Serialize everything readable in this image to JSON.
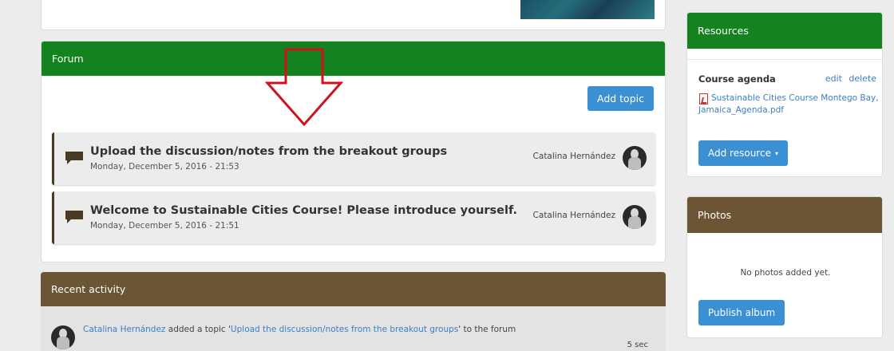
{
  "forum": {
    "header": "Forum",
    "add_topic_label": "Add topic",
    "topics": [
      {
        "title": "Upload the discussion/notes from the breakout groups",
        "date": "Monday, December 5, 2016 - 21:53",
        "author": "Catalina Hernández"
      },
      {
        "title": "Welcome to Sustainable Cities Course! Please introduce yourself.",
        "date": "Monday, December 5, 2016 - 21:51",
        "author": "Catalina Hernández"
      }
    ]
  },
  "activity": {
    "header": "Recent activity",
    "items": [
      {
        "user": "Catalina Hernández",
        "text_before": " added a topic '",
        "topic": "Upload the discussion/notes from the breakout groups",
        "text_after": "' to the forum",
        "time": "5 sec"
      }
    ]
  },
  "resources": {
    "header": "Resources",
    "item_title": "Course agenda",
    "edit_label": "edit",
    "delete_label": "delete",
    "file_name": "Sustainable Cities Course Montego Bay, Jamaica_Agenda.pdf",
    "add_button_label": "Add resource",
    "add_button_caret": "▾"
  },
  "photos": {
    "header": "Photos",
    "empty_text": "No photos added yet.",
    "publish_label": "Publish album"
  },
  "colors": {
    "green_header": "#14821f",
    "brown_header": "#6c5535",
    "button_blue": "#3b8fd3",
    "link_blue": "#3b7fc4",
    "annotation_red": "#d0121c"
  },
  "icons": {
    "topic_icon": "speech-bubble-icon",
    "file_icon": "pdf-file-icon",
    "annotation": "red-down-arrow-icon"
  }
}
